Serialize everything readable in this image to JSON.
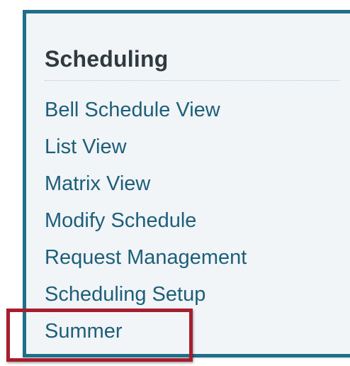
{
  "panel": {
    "title": "Scheduling",
    "items": [
      {
        "label": "Bell Schedule View"
      },
      {
        "label": "List View"
      },
      {
        "label": "Matrix View"
      },
      {
        "label": "Modify Schedule"
      },
      {
        "label": "Request Management"
      },
      {
        "label": "Scheduling Setup"
      },
      {
        "label": "Summer"
      }
    ]
  },
  "colors": {
    "panel_border": "#1f6e8a",
    "panel_background": "#f1f5f8",
    "title_text": "#2f3a40",
    "link_text": "#1d5f7b",
    "highlight_border": "#a61d2d"
  },
  "annotation": {
    "highlighted_item": "Summer"
  }
}
